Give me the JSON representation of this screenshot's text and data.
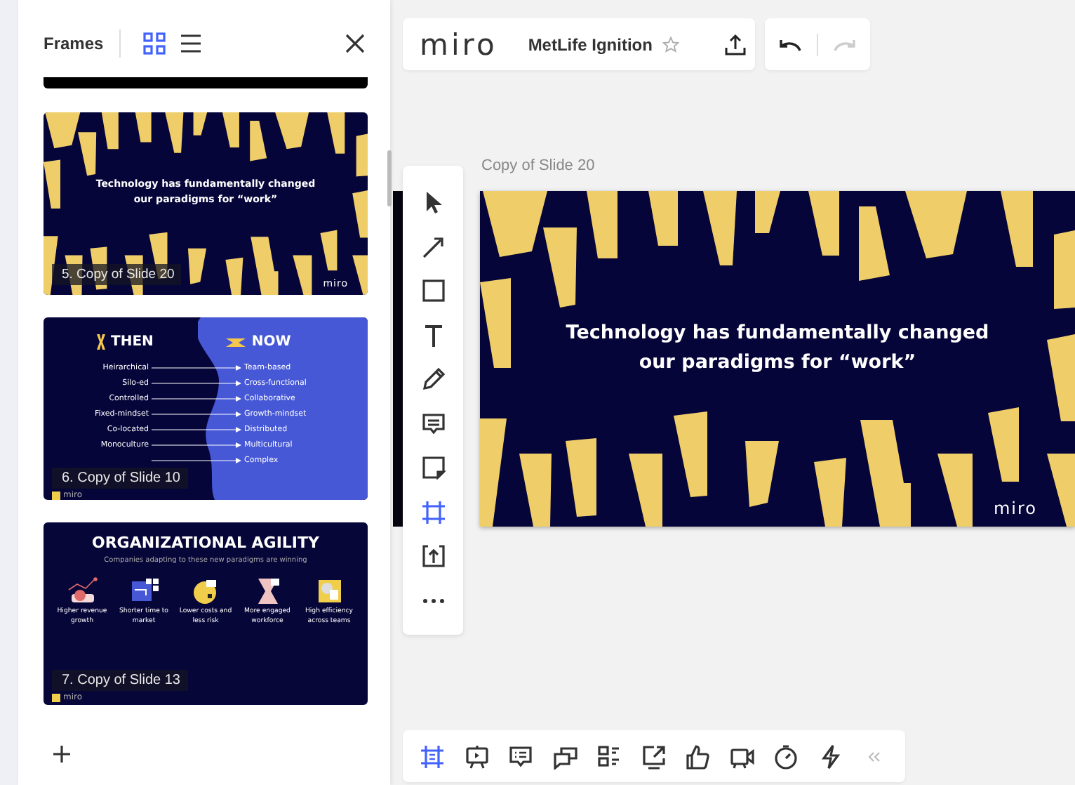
{
  "frames_panel": {
    "title": "Frames",
    "view_modes": [
      {
        "kind": "grid",
        "selected": true
      },
      {
        "kind": "list",
        "selected": false
      }
    ],
    "frames": [
      {
        "kind": "shapes",
        "caption": "5. Copy of Slide 20",
        "heading_lines": [
          "Technology has fundamentally changed",
          "our paradigms for “work”"
        ],
        "logo": "miro"
      },
      {
        "kind": "then_now",
        "caption": "6. Copy of Slide 10",
        "then_label": "THEN",
        "now_label": "NOW",
        "pairs": [
          {
            "from": "Heirarchical",
            "to": "Team-based"
          },
          {
            "from": "Silo-ed",
            "to": "Cross-functional"
          },
          {
            "from": "Controlled",
            "to": "Collaborative"
          },
          {
            "from": "Fixed-mindset",
            "to": "Growth-mindset"
          },
          {
            "from": "Co-located",
            "to": "Distributed"
          },
          {
            "from": "Monoculture",
            "to": "Multicultural"
          },
          {
            "to": "Complex"
          }
        ],
        "logo": "miro"
      },
      {
        "kind": "agility",
        "caption": "7. Copy of Slide 13",
        "title": "ORGANIZATIONAL AGILITY",
        "subtitle": "Companies adapting to these new paradigms are winning",
        "items": [
          "Higher revenue growth",
          "Shorter time to market",
          "Lower costs and less risk",
          "More engaged workforce",
          "High efficiency across teams"
        ],
        "logo": "miro"
      }
    ]
  },
  "board_bar": {
    "logo": "miro",
    "board_name": "MetLife Ignition",
    "starred": false
  },
  "history": [
    {
      "kind": "undo",
      "disabled": false
    },
    {
      "kind": "redo",
      "disabled": true
    }
  ],
  "canvas": {
    "frame_title": "Copy of Slide 20",
    "frame": {
      "heading_lines": [
        "Technology has fundamentally changed",
        "our paradigms for “work”"
      ],
      "logo": "miro"
    }
  },
  "tools": [
    {
      "kind": "select",
      "selected": false
    },
    {
      "kind": "line",
      "selected": false
    },
    {
      "kind": "shape",
      "selected": false
    },
    {
      "kind": "text",
      "selected": false
    },
    {
      "kind": "pen",
      "selected": false
    },
    {
      "kind": "comment",
      "selected": false
    },
    {
      "kind": "sticky",
      "selected": false
    },
    {
      "kind": "frame",
      "selected": true
    },
    {
      "kind": "upload",
      "selected": false
    },
    {
      "kind": "more",
      "selected": false
    }
  ],
  "bottom_tools": [
    {
      "kind": "frames",
      "selected": true
    },
    {
      "kind": "present",
      "selected": false
    },
    {
      "kind": "comments",
      "selected": false
    },
    {
      "kind": "cards",
      "selected": false
    },
    {
      "kind": "list",
      "selected": false
    },
    {
      "kind": "share",
      "selected": false
    },
    {
      "kind": "vote",
      "selected": false
    },
    {
      "kind": "video",
      "selected": false
    },
    {
      "kind": "timer",
      "selected": false
    },
    {
      "kind": "bolt",
      "selected": false
    },
    {
      "kind": "collapse"
    }
  ]
}
